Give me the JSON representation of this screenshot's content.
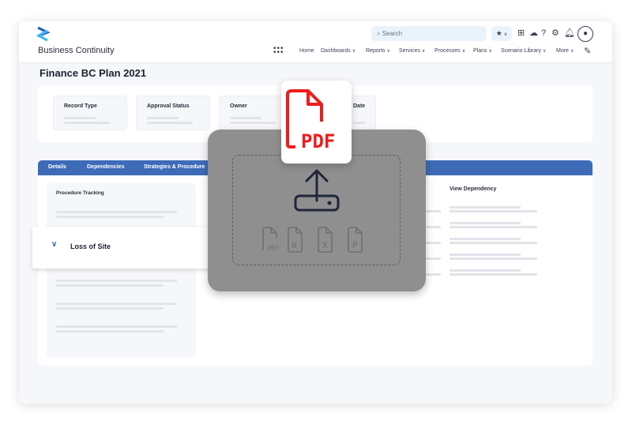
{
  "app": {
    "name": "Business Continuity"
  },
  "header": {
    "search_placeholder": "Search",
    "nav": [
      "Home",
      "Dashboards",
      "Reports",
      "Services",
      "Processes",
      "Plans",
      "Scenario Library",
      "More"
    ]
  },
  "page": {
    "title": "Finance BC Plan 2021"
  },
  "summary": {
    "cards": [
      "Record Type",
      "Approval Status",
      "Owner",
      "Date"
    ]
  },
  "tabs": [
    "Details",
    "Dependencies",
    "Strategies & Procedure"
  ],
  "procedure": {
    "title": "Procedure Tracking",
    "expanded_item": "Loss of Site"
  },
  "dependency": {
    "title": "View Dependency"
  },
  "upload": {
    "highlight_file_type": "PDF",
    "file_types": [
      "PDF",
      "W",
      "X",
      "P"
    ],
    "colors": {
      "pdf": "#ee1c1c",
      "overlay": "#8f8f8f"
    }
  },
  "colors": {
    "tab_bar": "#3d6bb8",
    "brand_dark": "#1f5fbf",
    "brand_light": "#3fb6f0"
  }
}
